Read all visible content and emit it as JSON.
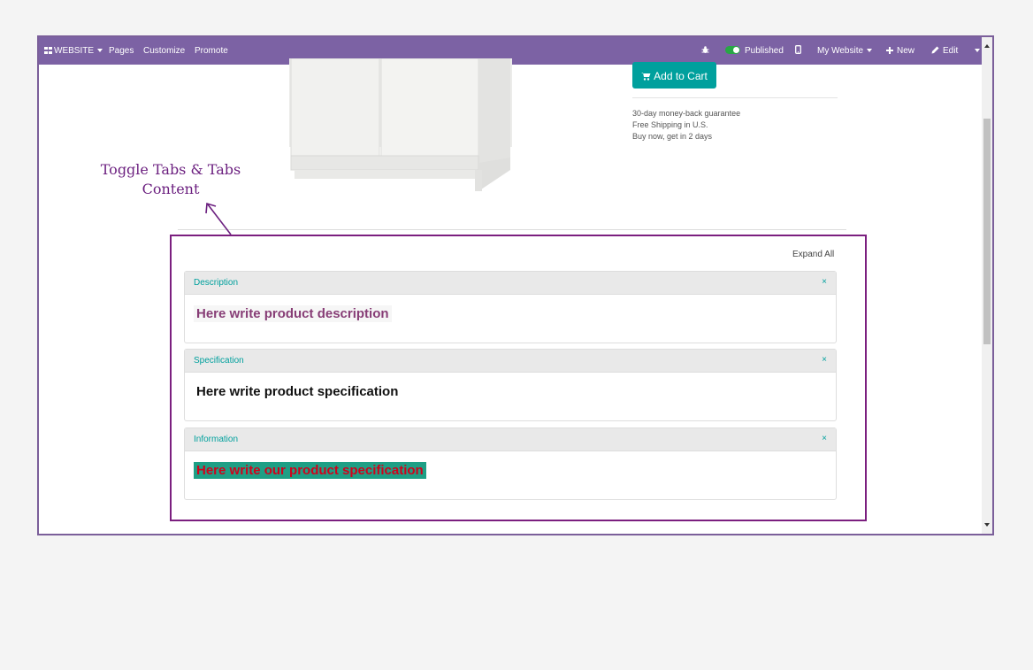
{
  "topbar": {
    "website_label": "WEBSITE",
    "pages_label": "Pages",
    "customize_label": "Customize",
    "promote_label": "Promote",
    "published_label": "Published",
    "my_website_label": "My Website",
    "new_label": "New",
    "edit_label": "Edit"
  },
  "product": {
    "add_to_cart_label": "Add to Cart",
    "perks": [
      "30-day money-back guarantee",
      "Free Shipping in U.S.",
      "Buy now, get in 2 days"
    ]
  },
  "tabs": {
    "expand_all_label": "Expand All",
    "close_glyph": "×",
    "panels": [
      {
        "title": "Description",
        "content": "Here write product description"
      },
      {
        "title": "Specification",
        "content": "Here write product specification"
      },
      {
        "title": "Information",
        "content": "Here write our product specification"
      }
    ]
  },
  "annotation": {
    "line1": "Toggle Tabs & Tabs",
    "line2": "Content"
  },
  "colors": {
    "topbar_bg": "#7c62a4",
    "accent_teal": "#00a09d",
    "annotation_purple": "#6b1f7f",
    "description_text": "#873d76",
    "information_text": "#d0021b",
    "information_highlight": "#1e9f85"
  }
}
